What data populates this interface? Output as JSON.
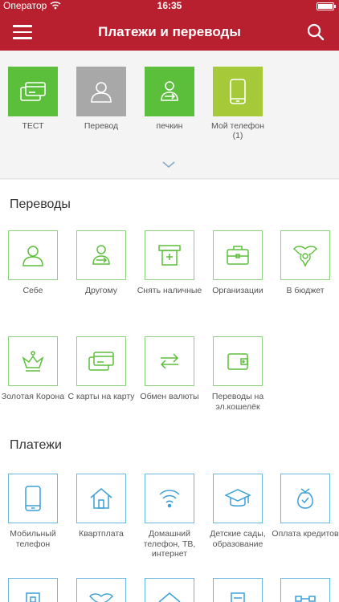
{
  "statusbar": {
    "carrier": "Оператор",
    "time": "16:35"
  },
  "navbar": {
    "title": "Платежи и переводы"
  },
  "favorites": [
    {
      "label": "ТЕСТ",
      "color": "#5cbf3c",
      "icon": "card-icon"
    },
    {
      "label": "Перевод",
      "color": "#a8a8a8",
      "icon": "person-icon"
    },
    {
      "label": "печкин",
      "color": "#5cbf3c",
      "icon": "person-transfer-icon"
    },
    {
      "label": "Мой телефон (1)",
      "color": "#a6c93a",
      "icon": "phone-icon"
    }
  ],
  "transfers": {
    "title": "Переводы",
    "items": [
      {
        "label": "Себе",
        "icon": "person-icon"
      },
      {
        "label": "Другому",
        "icon": "person-transfer-icon"
      },
      {
        "label": "Снять наличные",
        "icon": "atm-icon"
      },
      {
        "label": "Организации",
        "icon": "briefcase-icon"
      },
      {
        "label": "В бюджет",
        "icon": "emblem-icon"
      },
      {
        "label": "Золотая Корона",
        "icon": "crown-icon"
      },
      {
        "label": "С карты на карту",
        "icon": "cards-icon"
      },
      {
        "label": "Обмен валюты",
        "icon": "exchange-icon"
      },
      {
        "label": "Переводы на эл.кошелёк",
        "icon": "wallet-icon"
      }
    ]
  },
  "payments": {
    "title": "Платежи",
    "items": [
      {
        "label": "Мобильный телефон",
        "icon": "mobile-icon"
      },
      {
        "label": "Квартплата",
        "icon": "house-icon"
      },
      {
        "label": "Домашний телефон, ТВ, интернет",
        "icon": "wifi-icon"
      },
      {
        "label": "Детские сады, образование",
        "icon": "graduation-cap-icon"
      },
      {
        "label": "Оплата кредитов",
        "icon": "money-bag-icon"
      }
    ]
  }
}
